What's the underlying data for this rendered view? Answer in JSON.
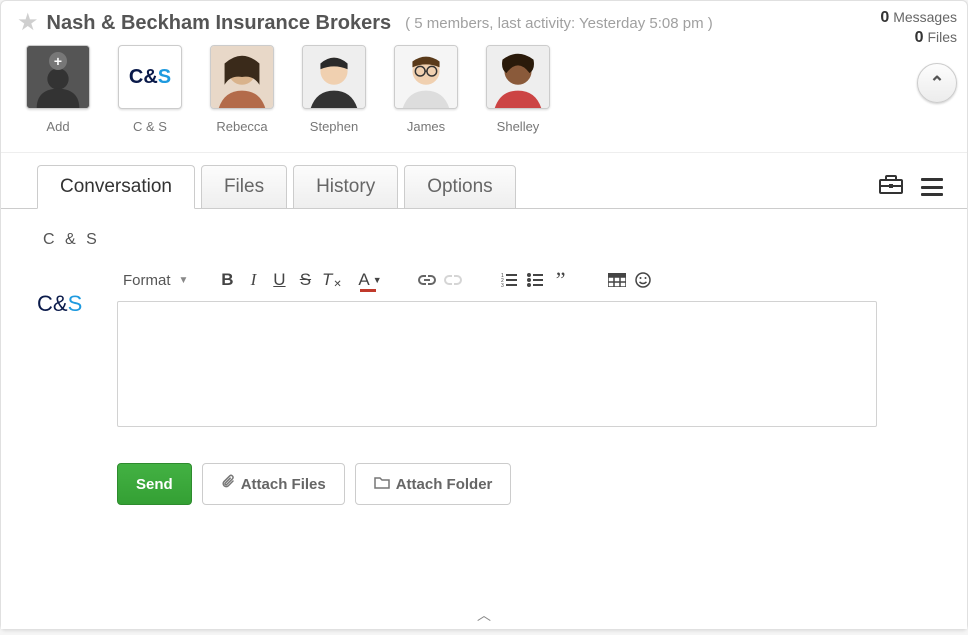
{
  "header": {
    "title": "Nash & Beckham Insurance Brokers",
    "meta": "( 5 members, last activity: Yesterday 5:08 pm )",
    "stats": {
      "messages_count": "0",
      "messages_label": "Messages",
      "files_count": "0",
      "files_label": "Files"
    }
  },
  "members": [
    {
      "name": "Add",
      "kind": "add"
    },
    {
      "name": "C & S",
      "kind": "cs"
    },
    {
      "name": "Rebecca",
      "kind": "person"
    },
    {
      "name": "Stephen",
      "kind": "person"
    },
    {
      "name": "James",
      "kind": "person"
    },
    {
      "name": "Shelley",
      "kind": "person"
    }
  ],
  "tabs": {
    "conversation": "Conversation",
    "files": "Files",
    "history": "History",
    "options": "Options"
  },
  "composer": {
    "author_label": "C & S",
    "format_label": "Format",
    "send": "Send",
    "attach_files": "Attach Files",
    "attach_folder": "Attach Folder"
  }
}
